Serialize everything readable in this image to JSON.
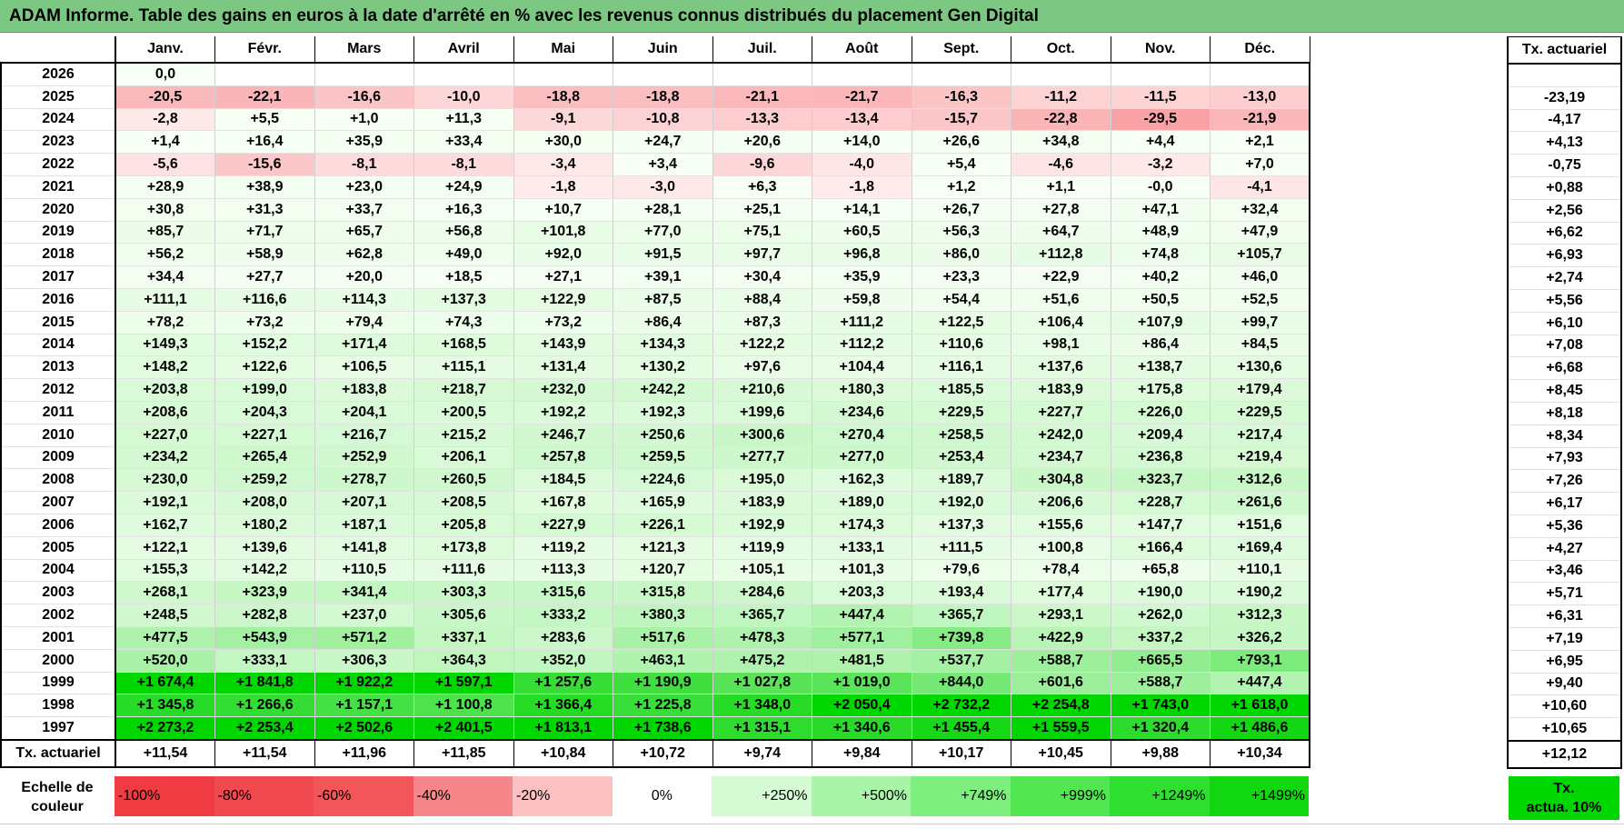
{
  "title": "ADAM Informe. Table des gains en euros à la date d'arrêté en % avec les revenus connus distribués du placement Gen Digital",
  "months": [
    "Janv.",
    "Févr.",
    "Mars",
    "Avril",
    "Mai",
    "Juin",
    "Juil.",
    "Août",
    "Sept.",
    "Oct.",
    "Nov.",
    "Déc."
  ],
  "tx_header": "Tx. actuariel",
  "rows": [
    {
      "year": "2026",
      "values": [
        "0,0",
        "",
        "",
        "",
        "",
        "",
        "",
        "",
        "",
        "",
        "",
        ""
      ],
      "tx": ""
    },
    {
      "year": "2025",
      "values": [
        "-20,5",
        "-22,1",
        "-16,6",
        "-10,0",
        "-18,8",
        "-18,8",
        "-21,1",
        "-21,7",
        "-16,3",
        "-11,2",
        "-11,5",
        "-13,0"
      ],
      "tx": "-23,19"
    },
    {
      "year": "2024",
      "values": [
        "-2,8",
        "+5,5",
        "+1,0",
        "+11,3",
        "-9,1",
        "-10,8",
        "-13,3",
        "-13,4",
        "-15,7",
        "-22,8",
        "-29,5",
        "-21,9"
      ],
      "tx": "-4,17"
    },
    {
      "year": "2023",
      "values": [
        "+1,4",
        "+16,4",
        "+35,9",
        "+33,4",
        "+30,0",
        "+24,7",
        "+20,6",
        "+14,0",
        "+26,6",
        "+34,8",
        "+4,4",
        "+2,1"
      ],
      "tx": "+4,13"
    },
    {
      "year": "2022",
      "values": [
        "-5,6",
        "-15,6",
        "-8,1",
        "-8,1",
        "-3,4",
        "+3,4",
        "-9,6",
        "-4,0",
        "+5,4",
        "-4,6",
        "-3,2",
        "+7,0"
      ],
      "tx": "-0,75"
    },
    {
      "year": "2021",
      "values": [
        "+28,9",
        "+38,9",
        "+23,0",
        "+24,9",
        "-1,8",
        "-3,0",
        "+6,3",
        "-1,8",
        "+1,2",
        "+1,1",
        "-0,0",
        "-4,1"
      ],
      "tx": "+0,88"
    },
    {
      "year": "2020",
      "values": [
        "+30,8",
        "+31,3",
        "+33,7",
        "+16,3",
        "+10,7",
        "+28,1",
        "+25,1",
        "+14,1",
        "+26,7",
        "+27,8",
        "+47,1",
        "+32,4"
      ],
      "tx": "+2,56"
    },
    {
      "year": "2019",
      "values": [
        "+85,7",
        "+71,7",
        "+65,7",
        "+56,8",
        "+101,8",
        "+77,0",
        "+75,1",
        "+60,5",
        "+56,3",
        "+64,7",
        "+48,9",
        "+47,9"
      ],
      "tx": "+6,62"
    },
    {
      "year": "2018",
      "values": [
        "+56,2",
        "+58,9",
        "+62,8",
        "+49,0",
        "+92,0",
        "+91,5",
        "+97,7",
        "+96,8",
        "+86,0",
        "+112,8",
        "+74,8",
        "+105,7"
      ],
      "tx": "+6,93"
    },
    {
      "year": "2017",
      "values": [
        "+34,4",
        "+27,7",
        "+20,0",
        "+18,5",
        "+27,1",
        "+39,1",
        "+30,4",
        "+35,9",
        "+23,3",
        "+22,9",
        "+40,2",
        "+46,0"
      ],
      "tx": "+2,74"
    },
    {
      "year": "2016",
      "values": [
        "+111,1",
        "+116,6",
        "+114,3",
        "+137,3",
        "+122,9",
        "+87,5",
        "+88,4",
        "+59,8",
        "+54,4",
        "+51,6",
        "+50,5",
        "+52,5"
      ],
      "tx": "+5,56"
    },
    {
      "year": "2015",
      "values": [
        "+78,2",
        "+73,2",
        "+79,4",
        "+74,3",
        "+73,2",
        "+86,4",
        "+87,3",
        "+111,2",
        "+122,5",
        "+106,4",
        "+107,9",
        "+99,7"
      ],
      "tx": "+6,10"
    },
    {
      "year": "2014",
      "values": [
        "+149,3",
        "+152,2",
        "+171,4",
        "+168,5",
        "+143,9",
        "+134,3",
        "+122,2",
        "+112,2",
        "+110,6",
        "+98,1",
        "+86,4",
        "+84,5"
      ],
      "tx": "+7,08"
    },
    {
      "year": "2013",
      "values": [
        "+148,2",
        "+122,6",
        "+106,5",
        "+115,1",
        "+131,4",
        "+130,2",
        "+97,6",
        "+104,4",
        "+116,1",
        "+137,6",
        "+138,7",
        "+130,6"
      ],
      "tx": "+6,68"
    },
    {
      "year": "2012",
      "values": [
        "+203,8",
        "+199,0",
        "+183,8",
        "+218,7",
        "+232,0",
        "+242,2",
        "+210,6",
        "+180,3",
        "+185,5",
        "+183,9",
        "+175,8",
        "+179,4"
      ],
      "tx": "+8,45"
    },
    {
      "year": "2011",
      "values": [
        "+208,6",
        "+204,3",
        "+204,1",
        "+200,5",
        "+192,2",
        "+192,3",
        "+199,6",
        "+234,6",
        "+229,5",
        "+227,7",
        "+226,0",
        "+229,5"
      ],
      "tx": "+8,18"
    },
    {
      "year": "2010",
      "values": [
        "+227,0",
        "+227,1",
        "+216,7",
        "+215,2",
        "+246,7",
        "+250,6",
        "+300,6",
        "+270,4",
        "+258,5",
        "+242,0",
        "+209,4",
        "+217,4"
      ],
      "tx": "+8,34"
    },
    {
      "year": "2009",
      "values": [
        "+234,2",
        "+265,4",
        "+252,9",
        "+206,1",
        "+257,8",
        "+259,5",
        "+277,7",
        "+277,0",
        "+253,4",
        "+234,7",
        "+236,8",
        "+219,4"
      ],
      "tx": "+7,93"
    },
    {
      "year": "2008",
      "values": [
        "+230,0",
        "+259,2",
        "+278,7",
        "+260,5",
        "+184,5",
        "+224,6",
        "+195,0",
        "+162,3",
        "+189,7",
        "+304,8",
        "+323,7",
        "+312,6"
      ],
      "tx": "+7,26"
    },
    {
      "year": "2007",
      "values": [
        "+192,1",
        "+208,0",
        "+207,1",
        "+208,5",
        "+167,8",
        "+165,9",
        "+183,9",
        "+189,0",
        "+192,0",
        "+206,6",
        "+228,7",
        "+261,6"
      ],
      "tx": "+6,17"
    },
    {
      "year": "2006",
      "values": [
        "+162,7",
        "+180,2",
        "+187,1",
        "+205,8",
        "+227,9",
        "+226,1",
        "+192,9",
        "+174,3",
        "+137,3",
        "+155,6",
        "+147,7",
        "+151,6"
      ],
      "tx": "+5,36"
    },
    {
      "year": "2005",
      "values": [
        "+122,1",
        "+139,6",
        "+141,8",
        "+173,8",
        "+119,2",
        "+121,3",
        "+119,9",
        "+133,1",
        "+111,5",
        "+100,8",
        "+166,4",
        "+169,4"
      ],
      "tx": "+4,27"
    },
    {
      "year": "2004",
      "values": [
        "+155,3",
        "+142,2",
        "+110,5",
        "+111,6",
        "+113,3",
        "+120,7",
        "+105,1",
        "+101,3",
        "+79,6",
        "+78,4",
        "+65,8",
        "+110,1"
      ],
      "tx": "+3,46"
    },
    {
      "year": "2003",
      "values": [
        "+268,1",
        "+323,9",
        "+341,4",
        "+303,3",
        "+315,6",
        "+315,8",
        "+284,6",
        "+203,3",
        "+193,4",
        "+177,4",
        "+190,0",
        "+190,2"
      ],
      "tx": "+5,71"
    },
    {
      "year": "2002",
      "values": [
        "+248,5",
        "+282,8",
        "+237,0",
        "+305,6",
        "+333,2",
        "+380,3",
        "+365,7",
        "+447,4",
        "+365,7",
        "+293,1",
        "+262,0",
        "+312,3"
      ],
      "tx": "+6,31"
    },
    {
      "year": "2001",
      "values": [
        "+477,5",
        "+543,9",
        "+571,2",
        "+337,1",
        "+283,6",
        "+517,6",
        "+478,3",
        "+577,1",
        "+739,8",
        "+422,9",
        "+337,2",
        "+326,2"
      ],
      "tx": "+7,19"
    },
    {
      "year": "2000",
      "values": [
        "+520,0",
        "+333,1",
        "+306,3",
        "+364,3",
        "+352,0",
        "+463,1",
        "+475,2",
        "+481,5",
        "+537,7",
        "+588,7",
        "+665,5",
        "+793,1"
      ],
      "tx": "+6,95"
    },
    {
      "year": "1999",
      "values": [
        "+1 674,4",
        "+1 841,8",
        "+1 922,2",
        "+1 597,1",
        "+1 257,6",
        "+1 190,9",
        "+1 027,8",
        "+1 019,0",
        "+844,0",
        "+601,6",
        "+588,7",
        "+447,4"
      ],
      "tx": "+9,40"
    },
    {
      "year": "1998",
      "values": [
        "+1 345,8",
        "+1 266,6",
        "+1 157,1",
        "+1 100,8",
        "+1 366,4",
        "+1 225,8",
        "+1 348,0",
        "+2 050,4",
        "+2 732,2",
        "+2 254,8",
        "+1 743,0",
        "+1 618,0"
      ],
      "tx": "+10,60"
    },
    {
      "year": "1997",
      "values": [
        "+2 273,2",
        "+2 253,4",
        "+2 502,6",
        "+2 401,5",
        "+1 813,1",
        "+1 738,6",
        "+1 315,1",
        "+1 340,6",
        "+1 455,4",
        "+1 559,5",
        "+1 320,4",
        "+1 486,6"
      ],
      "tx": "+10,65"
    }
  ],
  "footer": {
    "label": "Tx. actuariel",
    "values": [
      "+11,54",
      "+11,54",
      "+11,96",
      "+11,85",
      "+10,84",
      "+10,72",
      "+9,74",
      "+9,84",
      "+10,17",
      "+10,45",
      "+9,88",
      "+10,34"
    ],
    "tx": "+12,12"
  },
  "scale": {
    "label_line1": "Echelle de",
    "label_line2": "couleur",
    "items": [
      {
        "text": "-100%",
        "color": "#ee3c42"
      },
      {
        "text": "-80%",
        "color": "#f04a50"
      },
      {
        "text": "-60%",
        "color": "#f2565b"
      },
      {
        "text": "-40%",
        "color": "#f5868a"
      },
      {
        "text": "-20%",
        "color": "#fac0c2"
      },
      {
        "text": "0%",
        "color": "#ffffff"
      },
      {
        "text": "+250%",
        "color": "#d4fbd4"
      },
      {
        "text": "+500%",
        "color": "#a8f5a8"
      },
      {
        "text": "+749%",
        "color": "#7eef7e"
      },
      {
        "text": "+999%",
        "color": "#52e752"
      },
      {
        "text": "+1249%",
        "color": "#2fdf2f"
      },
      {
        "text": "+1499%",
        "color": "#10d710"
      }
    ],
    "tx_line1": "Tx.",
    "tx_line2": "actua. 10%",
    "tx_color": "#00d700"
  }
}
